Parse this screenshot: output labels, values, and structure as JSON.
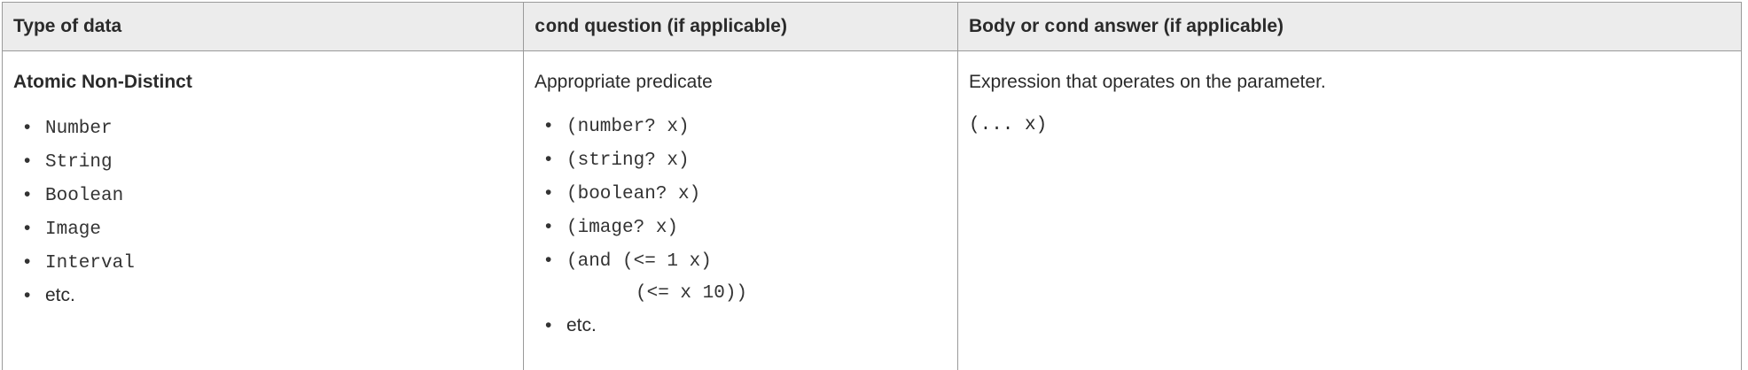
{
  "table": {
    "headers": {
      "col1": "Type of data",
      "col2_code": "cond",
      "col2_rest": " question (if applicable)",
      "col3_pre": "Body or ",
      "col3_code": "cond",
      "col3_rest": " answer (if applicable)"
    },
    "row": {
      "type_title": "Atomic Non-Distinct",
      "types": [
        "Number",
        "String",
        "Boolean",
        "Image",
        "Interval",
        "etc."
      ],
      "question_title": "Appropriate predicate",
      "predicates": [
        "(number? x)",
        "(string? x)",
        "(boolean? x)",
        "(image? x)",
        "(and (<= 1 x)",
        "etc."
      ],
      "predicate_continuation": "(<= x 10))",
      "answer_title": "Expression that operates on the parameter.",
      "answer_expr": "(... x)"
    }
  }
}
